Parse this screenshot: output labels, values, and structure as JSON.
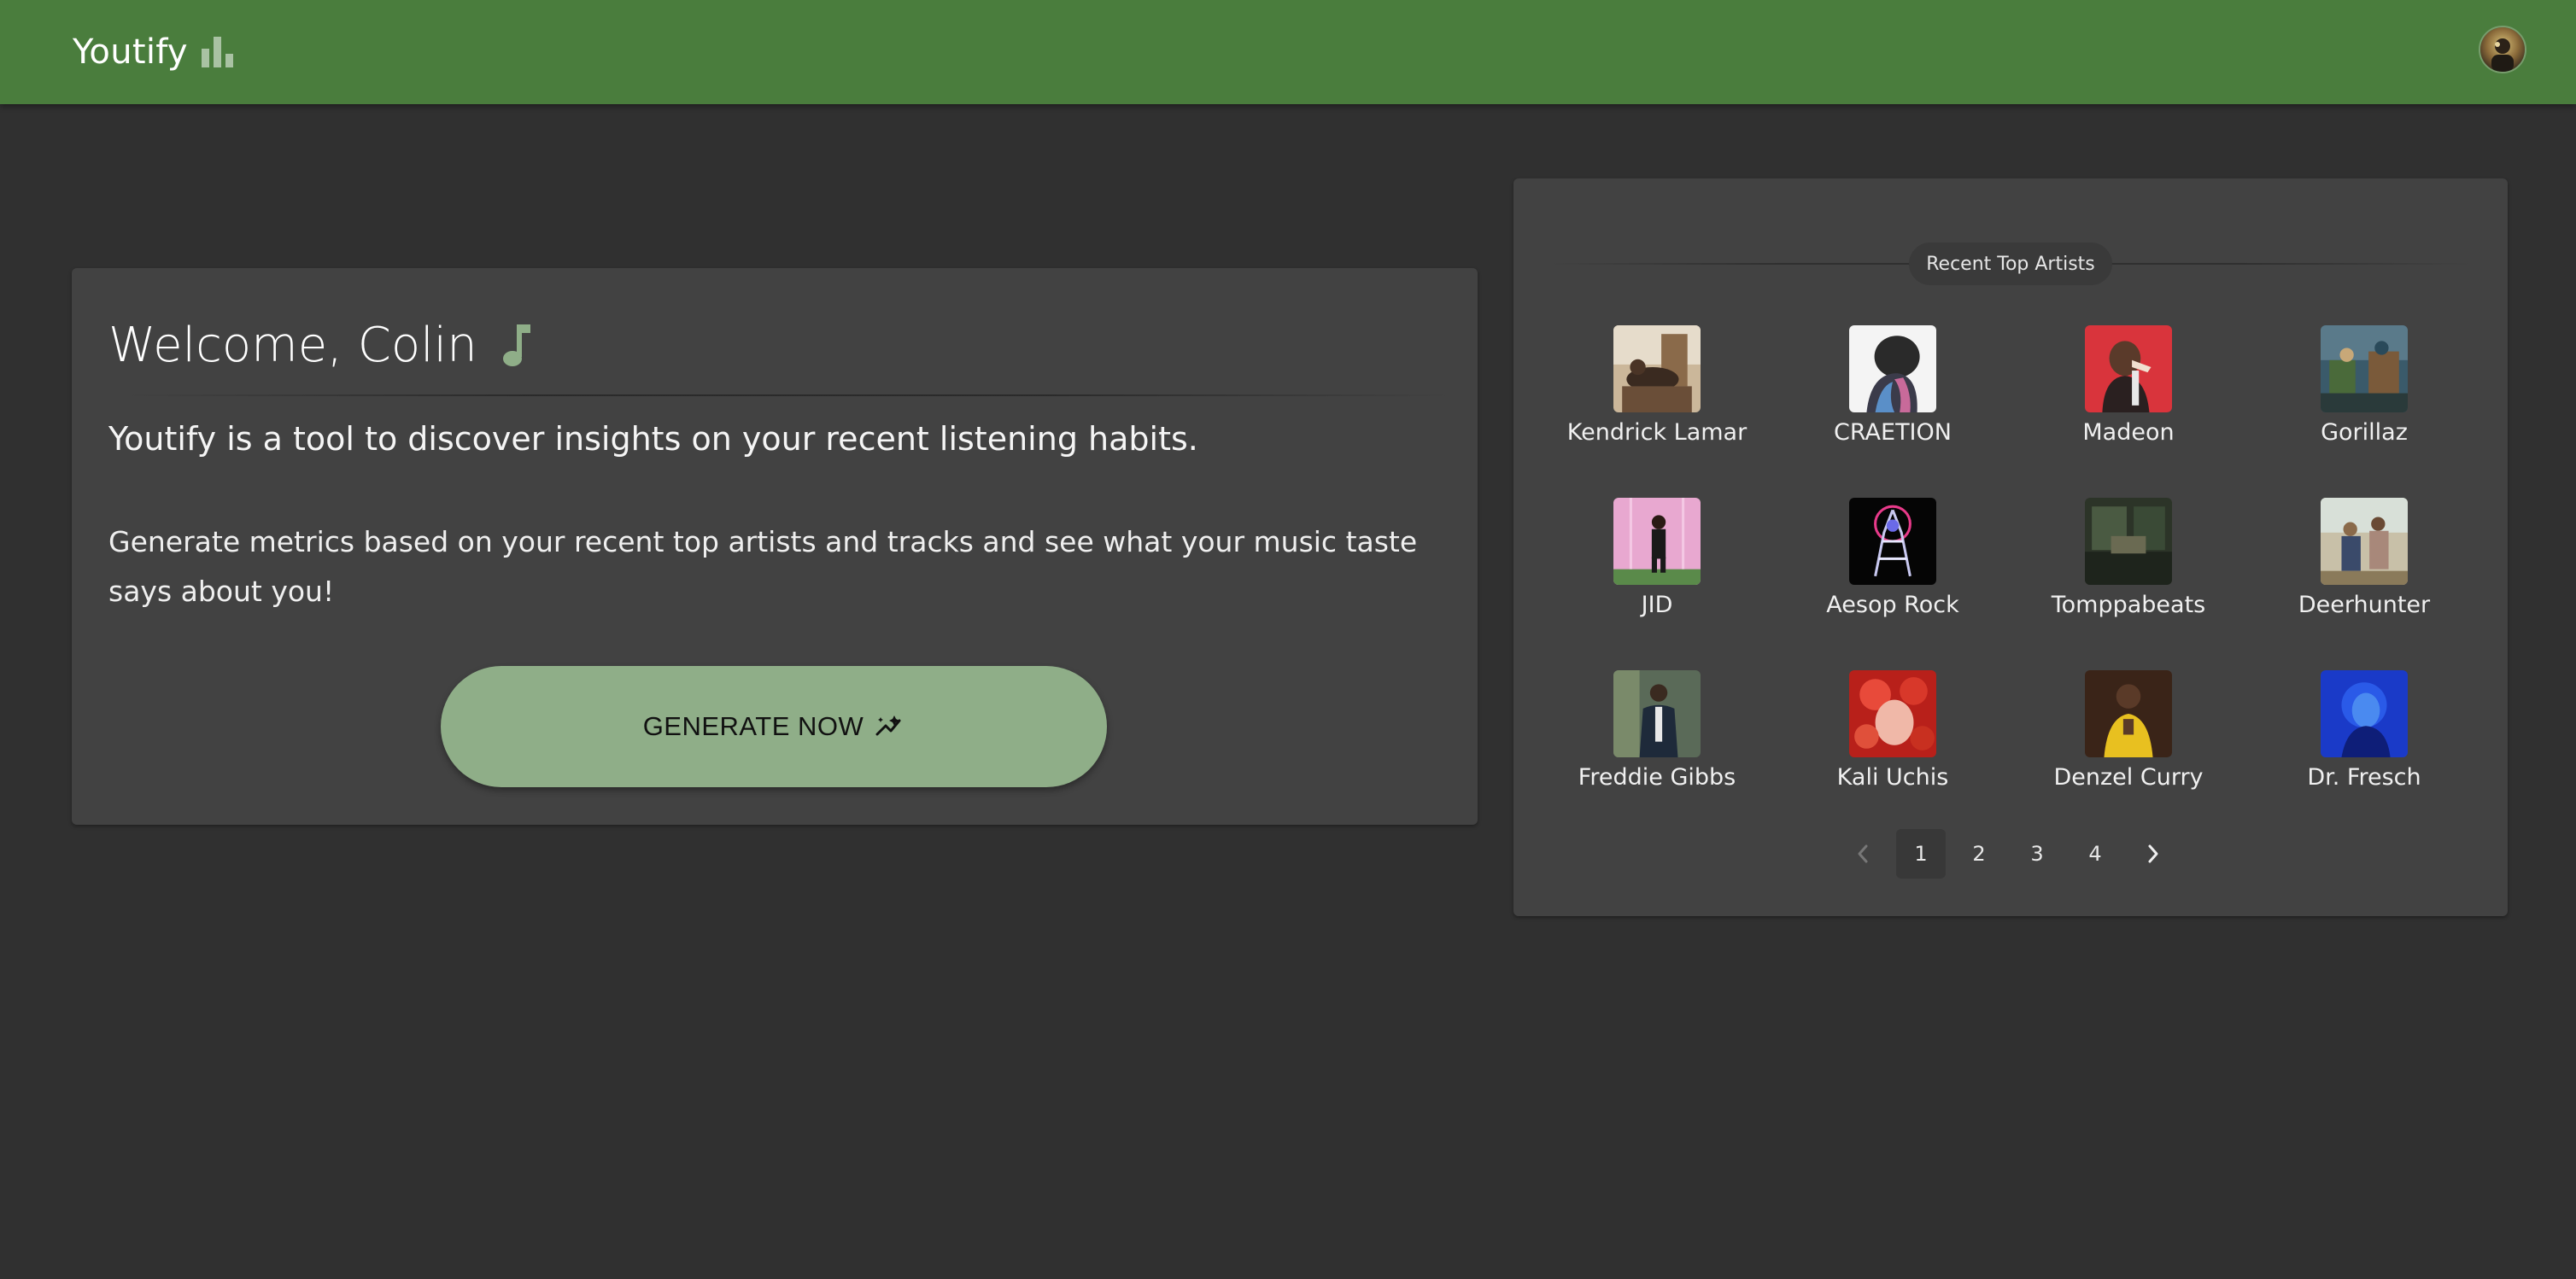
{
  "app": {
    "title": "Youtify",
    "logo_icon": "bar-chart-icon",
    "avatar_icon": "user-avatar"
  },
  "welcome": {
    "title": "Welcome, Colin",
    "title_icon": "music-note-icon",
    "lead": "Youtify is a tool to discover insights on your recent listening habits.",
    "body": "Generate metrics based on your recent top artists and tracks and see what your music taste says about you!",
    "button_label": "GENERATE NOW",
    "button_icon": "auto-fix-sparkle-icon"
  },
  "artists": {
    "heading": "Recent Top Artists",
    "items": [
      {
        "name": "Kendrick Lamar"
      },
      {
        "name": "CRAETION"
      },
      {
        "name": "Madeon"
      },
      {
        "name": "Gorillaz"
      },
      {
        "name": "JID"
      },
      {
        "name": "Aesop Rock"
      },
      {
        "name": "Tomppabeats"
      },
      {
        "name": "Deerhunter"
      },
      {
        "name": "Freddie Gibbs"
      },
      {
        "name": "Kali Uchis"
      },
      {
        "name": "Denzel Curry"
      },
      {
        "name": "Dr. Fresch"
      }
    ]
  },
  "pagination": {
    "pages": [
      "1",
      "2",
      "3",
      "4"
    ],
    "current": "1",
    "prev_icon": "chevron-left-icon",
    "next_icon": "chevron-right-icon"
  },
  "colors": {
    "appbar": "#4a7d3d",
    "background": "#303030",
    "card": "#424242",
    "accent": "#8fae88"
  }
}
